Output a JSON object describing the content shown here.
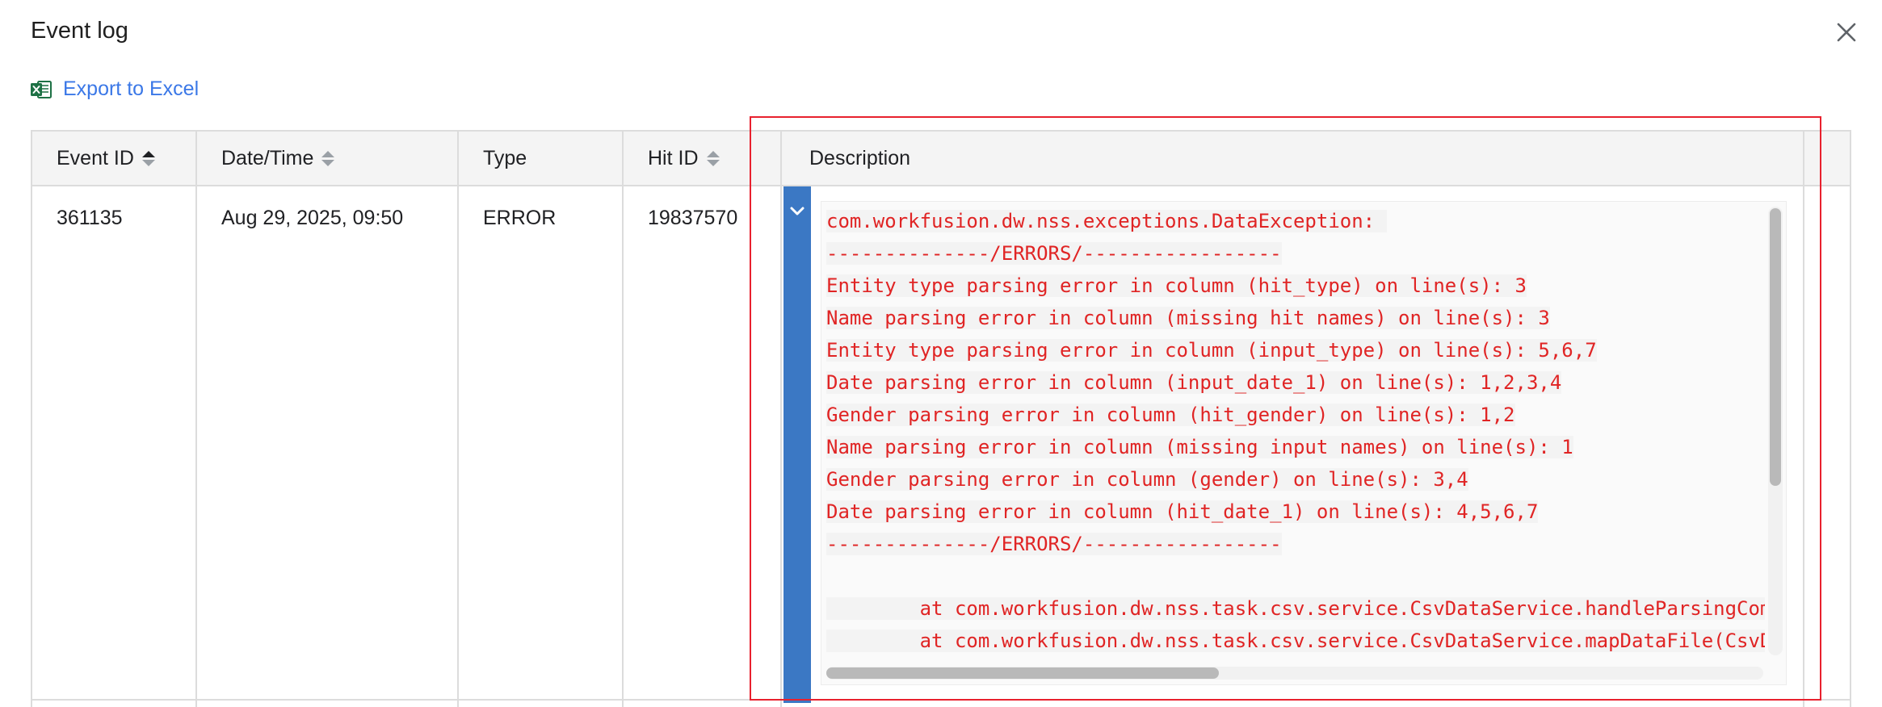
{
  "dialog": {
    "title": "Event log",
    "export_label": "Export to Excel"
  },
  "table": {
    "columns": [
      {
        "label": "Event ID",
        "sortable": true,
        "sort": "asc"
      },
      {
        "label": "Date/Time",
        "sortable": true,
        "sort": "none"
      },
      {
        "label": "Type",
        "sortable": false
      },
      {
        "label": "Hit ID",
        "sortable": true,
        "sort": "none"
      },
      {
        "label": "Description",
        "sortable": false
      }
    ],
    "rows": [
      {
        "event_id": "361135",
        "datetime": "Aug 29, 2025, 09:50",
        "type": "ERROR",
        "hit_id": "19837570",
        "description_lines": [
          "com.workfusion.dw.nss.exceptions.DataException: ",
          "--------------/ERRORS/-----------------",
          "Entity type parsing error in column (hit_type) on line(s): 3",
          "Name parsing error in column (missing hit names) on line(s): 3",
          "Entity type parsing error in column (input_type) on line(s): 5,6,7",
          "Date parsing error in column (input_date_1) on line(s): 1,2,3,4",
          "Gender parsing error in column (hit_gender) on line(s): 1,2",
          "Name parsing error in column (missing input names) on line(s): 1",
          "Gender parsing error in column (gender) on line(s): 3,4",
          "Date parsing error in column (hit_date_1) on line(s): 4,5,6,7",
          "--------------/ERRORS/-----------------",
          "",
          "        at com.workfusion.dw.nss.task.csv.service.CsvDataService.handleParsingCom",
          "        at com.workfusion.dw.nss.task.csv.service.CsvDataService.mapDataFile(CsvD"
        ]
      }
    ]
  },
  "colors": {
    "accent_blue": "#3b78c4",
    "link_blue": "#3b78e7",
    "error_red": "#e02424",
    "highlight_red": "#e8212e",
    "excel_green": "#1e7145"
  },
  "icons": {
    "close": "close-icon",
    "export": "excel-icon",
    "expand": "chevron-down-icon"
  }
}
